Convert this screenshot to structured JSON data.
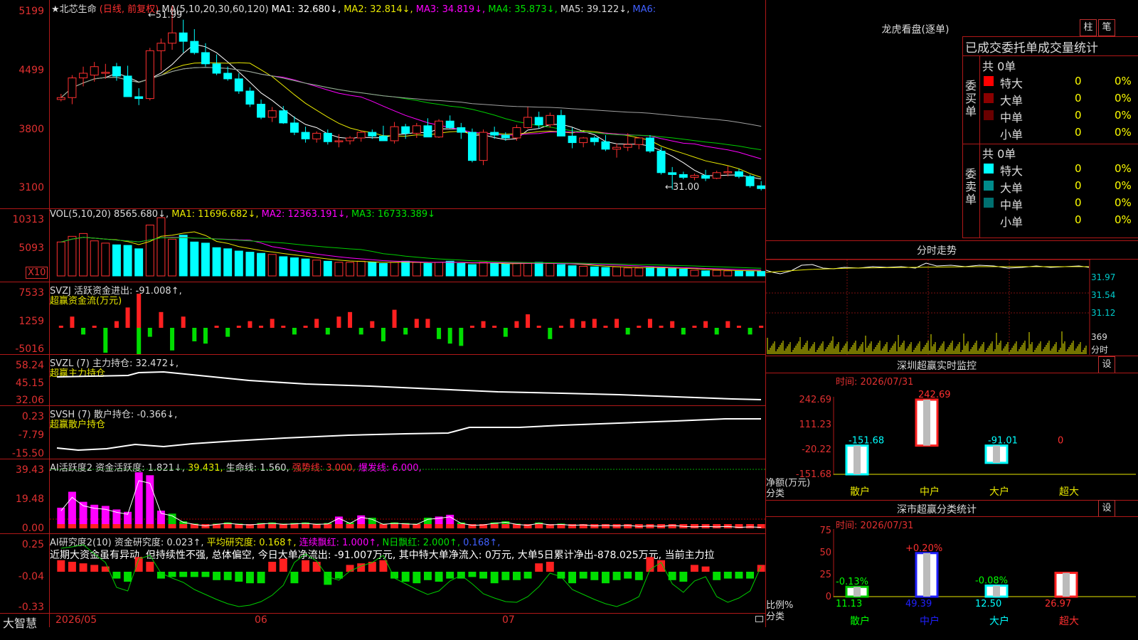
{
  "header": {
    "stock_name": "★北芯生命",
    "period": "(日线, 前复权)",
    "ma_label": "MA(5,10,20,30,60,120)",
    "ma1": "MA1: 32.680↓,",
    "ma2": "MA2: 32.814↓,",
    "ma3": "MA3: 34.819↓,",
    "ma4": "MA4: 35.873↓,",
    "ma5": "MA5: 39.122↓,",
    "ma6": "MA6:",
    "high_mark": "51.99",
    "low_mark": "31.00"
  },
  "price_axis": [
    "5199",
    "4499",
    "3800",
    "3100"
  ],
  "vol": {
    "label": "VOL(5,10,20)",
    "value": "8565.680↓,",
    "ma1": "MA1: 11696.682↓,",
    "ma2": "MA2: 12363.191↓,",
    "ma3": "MA3: 16733.389↓",
    "axis": [
      "10313",
      "5093"
    ],
    "unit": "X10"
  },
  "svzj": {
    "label": "SVZJ  活跃资金进出: -91.008↑,",
    "sub": "超赢资金流(万元)",
    "axis": [
      "7533",
      "1259",
      "-5016"
    ]
  },
  "svzl": {
    "label": "SVZL (7) 主力持仓: 32.472↓,",
    "sub": "超赢主力持仓",
    "axis": [
      "58.24",
      "45.15",
      "32.06"
    ]
  },
  "svsh": {
    "label": "SVSH (7) 散户持仓: -0.366↓,",
    "sub": "超赢散户持仓",
    "axis": [
      "0.23",
      "-7.79",
      "-15.50"
    ]
  },
  "ai_active": {
    "label": "AI活跃度2 资金活跃度: 1.821↓,",
    "v1": "39.431,",
    "v2": "生命线: 1.560,",
    "v3": "强势线: 3.000,",
    "v4": "爆发线: 6.000,",
    "axis": [
      "39.43",
      "19.48",
      "0.00"
    ]
  },
  "ai_research": {
    "label": "AI研究度2(10) 资金研究度: 0.023↑,",
    "v1": "平均研究度: 0.168↑,",
    "v2": "连续飘红: 1.000↑,",
    "v3": "N日飘红: 2.000↑,",
    "v4": "0.168↑,",
    "text": "近期大资金虽有异动, 但持续性不强, 总体偏空, 今日大单净流出: -91.007万元, 其中特大单净流入: 0万元, 大单5日累计净出-878.025万元, 当前主力拉",
    "axis": [
      "0.25",
      "-0.04",
      "-0.33"
    ]
  },
  "bottom": {
    "brand": "大智慧",
    "dates": [
      "2026/05",
      "06",
      "07"
    ]
  },
  "dragon": {
    "title": "龙虎看盘(逐单)",
    "btn1": "柱",
    "btn2": "笔",
    "subtitle": "已成交委托单成交量统计",
    "buy_label": "委买单",
    "sell_label": "委卖单",
    "buy_total": "共 0单",
    "sell_total": "共 0单",
    "buy_rows": [
      {
        "name": "特大",
        "count": "0",
        "pct": "0%",
        "color": "#ff0000"
      },
      {
        "name": "大单",
        "count": "0",
        "pct": "0%",
        "color": "#8b0000"
      },
      {
        "name": "中单",
        "count": "0",
        "pct": "0%",
        "color": "#6a0000"
      },
      {
        "name": "小单",
        "count": "0",
        "pct": "0%",
        "color": ""
      }
    ],
    "sell_rows": [
      {
        "name": "特大",
        "count": "0",
        "pct": "0%",
        "color": "#00ffff"
      },
      {
        "name": "大单",
        "count": "0",
        "pct": "0%",
        "color": "#008b8b"
      },
      {
        "name": "中单",
        "count": "0",
        "pct": "0%",
        "color": "#007070"
      },
      {
        "name": "小单",
        "count": "0",
        "pct": "0%",
        "color": ""
      }
    ]
  },
  "intraday": {
    "title": "分时走势",
    "axis": [
      "31.97",
      "31.54",
      "31.12",
      "369",
      "分时"
    ]
  },
  "sz_monitor": {
    "title": "深圳超赢实时监控",
    "settings": "设",
    "time": "时间: 2026/07/31",
    "axis": [
      "242.69",
      "111.23",
      "-20.22",
      "-151.68"
    ],
    "unit": "净额(万元)",
    "cat_label": "分类",
    "bars": [
      {
        "cat": "散户",
        "value": -151.68,
        "label": "-151.68"
      },
      {
        "cat": "中户",
        "value": 242.69,
        "label": "242.69"
      },
      {
        "cat": "大户",
        "value": -91.01,
        "label": "-91.01"
      },
      {
        "cat": "超大",
        "value": 0,
        "label": "0"
      }
    ]
  },
  "sz_class": {
    "title": "深市超赢分类统计",
    "settings": "设",
    "time": "时间: 2026/07/31",
    "axis": [
      "75",
      "50",
      "25",
      "0"
    ],
    "unit": "比例%",
    "cat_label": "分类",
    "bars": [
      {
        "cat": "散户",
        "value": 11.13,
        "label": "11.13",
        "change": "-0.13%"
      },
      {
        "cat": "中户",
        "value": 49.39,
        "label": "49.39",
        "change": "+0.20%"
      },
      {
        "cat": "大户",
        "value": 12.5,
        "label": "12.50",
        "change": "-0.08%"
      },
      {
        "cat": "超大",
        "value": 26.97,
        "label": "26.97",
        "change": ""
      }
    ]
  },
  "colors": {
    "up": "#ff3030",
    "down": "#00ffff",
    "border": "#b01818",
    "ma1": "#ffffff",
    "ma2": "#e8e800",
    "ma3": "#ff00ff",
    "ma4": "#00cc00",
    "ma5": "#a0a0a0"
  },
  "chart_data": {
    "type": "candlestick",
    "values": [
      [
        42.0,
        42.6,
        41.8,
        42.2
      ],
      [
        42.2,
        44.6,
        41.5,
        44.3
      ],
      [
        44.3,
        45.5,
        43.4,
        44.8
      ],
      [
        44.6,
        46.0,
        43.9,
        45.5
      ],
      [
        44.8,
        45.8,
        44.2,
        44.9
      ],
      [
        45.5,
        45.9,
        44.0,
        44.5
      ],
      [
        44.5,
        45.6,
        42.5,
        42.3
      ],
      [
        42.3,
        43.2,
        41.4,
        42.1
      ],
      [
        42.1,
        47.5,
        41.9,
        47.2
      ],
      [
        47.2,
        48.5,
        45.1,
        48.0
      ],
      [
        48.0,
        51.99,
        47.3,
        49.1
      ],
      [
        49.1,
        50.5,
        47.0,
        48.2
      ],
      [
        48.2,
        49.5,
        46.8,
        47.0
      ],
      [
        47.0,
        48.0,
        45.5,
        45.8
      ],
      [
        45.8,
        46.8,
        44.6,
        44.8
      ],
      [
        44.8,
        45.5,
        44.0,
        44.2
      ],
      [
        44.2,
        44.8,
        42.6,
        42.9
      ],
      [
        42.9,
        43.3,
        41.2,
        41.5
      ],
      [
        41.5,
        42.0,
        39.9,
        40.1
      ],
      [
        40.1,
        41.2,
        39.6,
        40.8
      ],
      [
        40.8,
        41.3,
        39.4,
        39.5
      ],
      [
        39.5,
        40.2,
        38.2,
        38.5
      ],
      [
        38.5,
        39.1,
        37.4,
        37.8
      ],
      [
        37.8,
        38.6,
        37.4,
        38.4
      ],
      [
        38.4,
        38.8,
        37.2,
        37.5
      ],
      [
        37.5,
        38.3,
        36.9,
        37.6
      ],
      [
        37.6,
        38.1,
        37.2,
        37.9
      ],
      [
        37.9,
        38.7,
        37.5,
        38.5
      ],
      [
        38.5,
        38.8,
        37.8,
        38.1
      ],
      [
        38.1,
        39.2,
        37.9,
        37.6
      ],
      [
        37.6,
        39.6,
        37.3,
        39.1
      ],
      [
        39.1,
        39.4,
        37.8,
        38.4
      ],
      [
        38.4,
        39.5,
        37.9,
        39.2
      ],
      [
        39.2,
        40.0,
        38.0,
        38.0
      ],
      [
        38.0,
        39.9,
        37.9,
        39.7
      ],
      [
        39.7,
        40.3,
        38.9,
        39.0
      ],
      [
        39.0,
        39.5,
        37.8,
        38.5
      ],
      [
        38.5,
        38.9,
        35.3,
        35.5
      ],
      [
        35.5,
        38.8,
        35.0,
        38.5
      ],
      [
        38.5,
        39.1,
        37.8,
        38.2
      ],
      [
        38.2,
        38.5,
        37.6,
        37.9
      ],
      [
        37.9,
        39.3,
        37.6,
        39.0
      ],
      [
        39.0,
        41.2,
        38.9,
        40.1
      ],
      [
        40.1,
        40.7,
        38.9,
        39.3
      ],
      [
        39.3,
        40.6,
        39.0,
        40.3
      ],
      [
        40.3,
        40.9,
        39.1,
        38.1
      ],
      [
        38.1,
        39.0,
        36.8,
        37.4
      ],
      [
        37.4,
        38.0,
        36.9,
        37.9
      ],
      [
        37.9,
        38.1,
        37.1,
        37.5
      ],
      [
        37.5,
        38.2,
        36.5,
        36.7
      ],
      [
        36.7,
        37.3,
        35.8,
        36.9
      ],
      [
        36.9,
        38.4,
        36.5,
        37.2
      ],
      [
        37.2,
        38.0,
        36.7,
        37.9
      ],
      [
        37.9,
        38.2,
        36.3,
        36.5
      ],
      [
        36.5,
        36.9,
        34.0,
        34.2
      ],
      [
        34.2,
        34.8,
        32.4,
        34.0
      ],
      [
        34.0,
        34.3,
        33.5,
        33.7
      ],
      [
        33.7,
        34.1,
        33.4,
        33.9
      ],
      [
        33.9,
        34.5,
        33.3,
        33.6
      ],
      [
        33.6,
        34.4,
        33.5,
        34.2
      ],
      [
        34.2,
        34.9,
        33.8,
        34.3
      ],
      [
        34.3,
        34.6,
        33.6,
        33.8
      ],
      [
        33.8,
        34.0,
        32.6,
        32.8
      ],
      [
        32.8,
        33.3,
        32.3,
        32.5
      ]
    ],
    "volume": [
      60,
      70,
      75,
      62,
      58,
      55,
      54,
      48,
      90,
      103,
      65,
      72,
      60,
      58,
      50,
      48,
      44,
      42,
      40,
      38,
      34,
      32,
      30,
      28,
      26,
      24,
      24,
      26,
      24,
      22,
      24,
      26,
      24,
      22,
      24,
      26,
      22,
      20,
      24,
      22,
      21,
      22,
      22,
      24,
      22,
      20,
      18,
      17,
      16,
      15,
      16,
      14,
      14,
      15,
      14,
      13,
      12,
      10,
      9,
      10,
      9,
      9,
      8,
      8
    ],
    "price_range": [
      31.0,
      52.0
    ],
    "vol_range": [
      0,
      103.13
    ],
    "xlabel": "",
    "ylabel": ""
  }
}
